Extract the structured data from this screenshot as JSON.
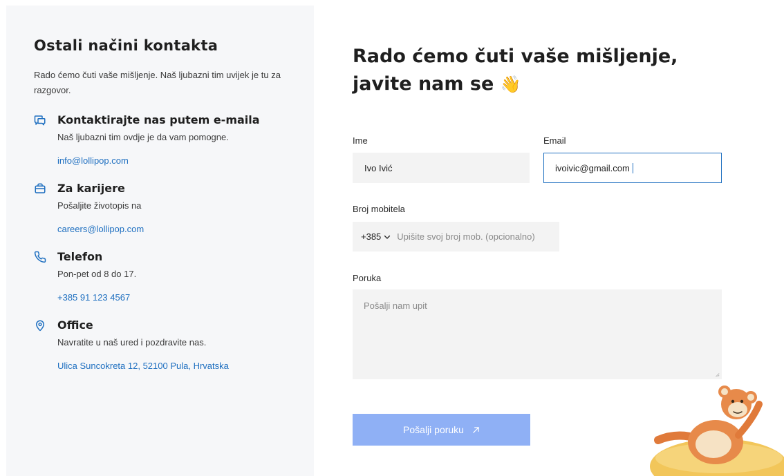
{
  "sidebar": {
    "title": "Ostali načini kontakta",
    "intro": "Rado ćemo čuti vaše mišljenje. Naš ljubazni tim uvijek je tu za razgovor.",
    "items": [
      {
        "icon": "chat-icon",
        "title": "Kontaktirajte nas putem e-maila",
        "desc": "Naš ljubazni tim ovdje je da vam pomogne.",
        "link": "info@lollipop.com"
      },
      {
        "icon": "briefcase-icon",
        "title": "Za karijere",
        "desc": "Pošaljite životopis na",
        "link": "careers@lollipop.com"
      },
      {
        "icon": "phone-icon",
        "title": "Telefon",
        "desc": "Pon-pet od 8 do 17.",
        "link": "+385 91 123 4567"
      },
      {
        "icon": "location-pin-icon",
        "title": "Office",
        "desc": "Navratite u naš ured i pozdravite nas.",
        "link": "Ulica Suncokreta 12, 52100 Pula, Hrvatska"
      }
    ]
  },
  "form": {
    "heading": "Rado ćemo čuti vaše mišljenje, javite nam se",
    "heading_emoji": "👋",
    "name_label": "Ime",
    "name_value": "Ivo Ivić",
    "email_label": "Email",
    "email_value": "ivoivic@gmail.com",
    "phone_label": "Broj mobitela",
    "phone_code": "+385",
    "phone_placeholder": "Upišite svoj broj mob. (opcionalno)",
    "message_label": "Poruka",
    "message_placeholder": "Pošalji nam upit",
    "submit_label": "Pošalji poruku"
  },
  "colors": {
    "accent": "#1e6fc0",
    "sidebar_bg": "#f6f7f9",
    "submit_bg": "#8fb0f5"
  }
}
